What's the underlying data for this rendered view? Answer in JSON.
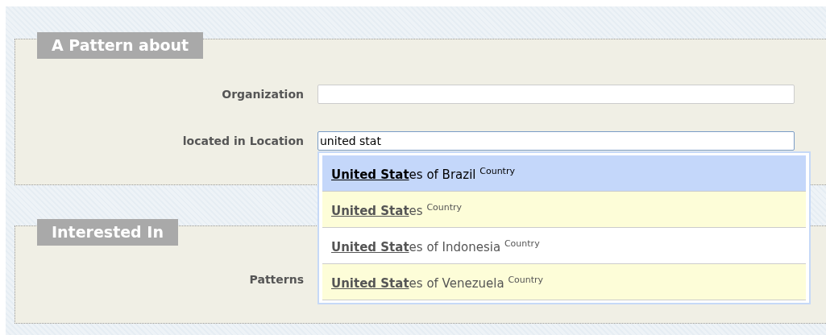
{
  "sections": [
    {
      "title": "A Pattern about",
      "fields": [
        {
          "label": "Organization",
          "kind": "text"
        },
        {
          "label": "located in Location",
          "kind": "text",
          "value": "united stat",
          "focused": true
        }
      ]
    },
    {
      "title": "Interested In",
      "fields": [
        {
          "label": "Patterns"
        }
      ]
    }
  ],
  "suggestions": [
    {
      "match": "United Stat",
      "rest": "es of Brazil",
      "type": "Country",
      "selected": true
    },
    {
      "match": "United Stat",
      "rest": "es",
      "type": "Country",
      "selected": false
    },
    {
      "match": "United Stat",
      "rest": "es of Indonesia",
      "type": "Country",
      "selected": false
    },
    {
      "match": "United Stat",
      "rest": "es of Venezuela",
      "type": "Country",
      "selected": false
    }
  ]
}
